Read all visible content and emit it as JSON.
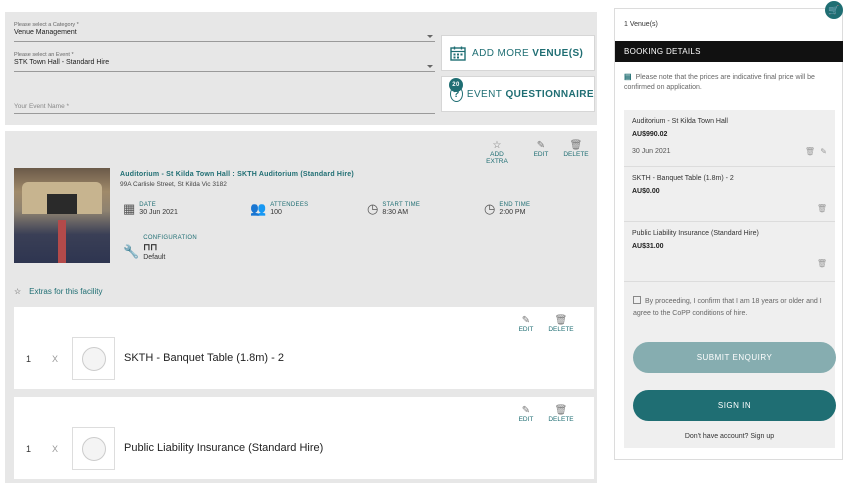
{
  "form": {
    "category_label": "Please select a Category *",
    "category_value": "Venue Management",
    "event_label": "Please select an Event *",
    "event_value": "STK Town Hall - Standard Hire",
    "event_name_placeholder": "Your Event Name *",
    "add_venue_prefix": "ADD MORE",
    "add_venue_bold": "VENUE(S)",
    "questionnaire_badge": "20",
    "questionnaire_prefix": "EVENT",
    "questionnaire_bold": "QUESTIONNAIRE"
  },
  "venue": {
    "title": "Auditorium - St Kilda Town Hall : SKTH Auditorium (Standard Hire)",
    "address": "99A Carlisle Street, St Kilda Vic 3182",
    "date_label": "DATE",
    "date_value": "30 Jun 2021",
    "attendees_label": "ATTENDEES",
    "attendees_value": "100",
    "start_label": "START TIME",
    "start_value": "8:30 AM",
    "end_label": "END TIME",
    "end_value": "2:00 PM",
    "config_label": "CONFIGURATION",
    "config_value": "Default",
    "add_extra_label": "ADD EXTRA",
    "edit_label": "EDIT",
    "delete_label": "DELETE"
  },
  "extras": {
    "link_label": "Extras for this facility",
    "items": [
      {
        "qty": "1",
        "x": "X",
        "name": "SKTH - Banquet Table (1.8m) - 2",
        "edit": "EDIT",
        "delete": "DELETE"
      },
      {
        "qty": "1",
        "x": "X",
        "name": "Public Liability Insurance (Standard Hire)",
        "edit": "EDIT",
        "delete": "DELETE"
      }
    ]
  },
  "booking": {
    "venue_count": "1 Venue(s)",
    "header": "BOOKING DETAILS",
    "note": "Please note that the prices are indicative final price will be confirmed on application.",
    "items": [
      {
        "title": "Auditorium - St Kilda Town Hall",
        "price": "AU$990.02",
        "date": "30 Jun 2021"
      },
      {
        "title": "SKTH - Banquet Table (1.8m) - 2",
        "price": "AU$0.00"
      },
      {
        "title": "Public Liability Insurance (Standard Hire)",
        "price": "AU$31.00"
      }
    ],
    "terms": "By proceeding, I confirm that I am 18 years or older and I agree to the CoPP conditions of hire.",
    "submit_label": "SUBMIT ENQUIRY",
    "signin_label": "SIGN IN",
    "signup_text": "Don't have account? Sign up"
  },
  "icons": {
    "calendar": "calendar-icon",
    "question": "question-icon",
    "star": "star-icon",
    "edit": "edit-icon",
    "trash": "trash-icon",
    "person": "person-icon",
    "clock": "clock-icon",
    "wrench": "wrench-icon",
    "cart": "cart-icon"
  },
  "colors": {
    "accent": "#1f6e73",
    "accent_light": "#86adb0",
    "panel_bg": "#e7e7e7",
    "header_bg": "#111111"
  }
}
